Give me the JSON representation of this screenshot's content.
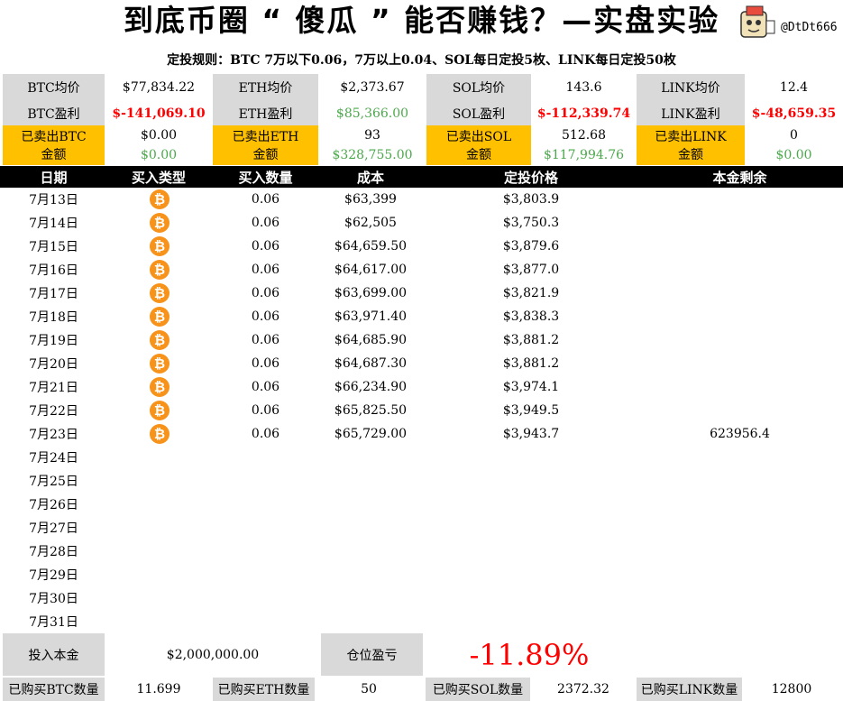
{
  "title": "到底币圈 “ 傻瓜 ” 能否赚钱？—实盘实验",
  "handle": "@DtDt666",
  "rule": "定投规则：BTC 7万以下0.06，7万以上0.04、SOL每日定投5枚、LINK每日定投50枚",
  "summary": {
    "row1": [
      {
        "label": "BTC均价",
        "value": "$77,834.22"
      },
      {
        "label": "ETH均价",
        "value": "$2,373.67"
      },
      {
        "label": "SOL均价",
        "value": "143.6"
      },
      {
        "label": "LINK均价",
        "value": "12.4"
      }
    ],
    "row2": [
      {
        "label": "BTC盈利",
        "value": "$-141,069.10"
      },
      {
        "label": "ETH盈利",
        "value": "$85,366.00"
      },
      {
        "label": "SOL盈利",
        "value": "$-112,339.74"
      },
      {
        "label": "LINK盈利",
        "value": "$-48,659.35"
      }
    ],
    "sold": [
      {
        "label1": "已卖出BTC",
        "label2": "金额",
        "qty": "$0.00",
        "amount": "$0.00"
      },
      {
        "label1": "已卖出ETH",
        "label2": "金额",
        "qty": "93",
        "amount": "$328,755.00"
      },
      {
        "label1": "已卖出SOL",
        "label2": "金额",
        "qty": "512.68",
        "amount": "$117,994.76"
      },
      {
        "label1": "已卖出LINK",
        "label2": "金额",
        "qty": "0",
        "amount": "$0.00"
      }
    ]
  },
  "table": {
    "headers": [
      "日期",
      "买入类型",
      "买入数量",
      "成本",
      "定投价格",
      "本金剩余"
    ],
    "rows": [
      {
        "date": "7月13日",
        "icon": "bitcoin-icon",
        "qty": "0.06",
        "cost": "$63,399",
        "price": "$3,803.9",
        "remaining": ""
      },
      {
        "date": "7月14日",
        "icon": "bitcoin-icon",
        "qty": "0.06",
        "cost": "$62,505",
        "price": "$3,750.3",
        "remaining": ""
      },
      {
        "date": "7月15日",
        "icon": "bitcoin-icon",
        "qty": "0.06",
        "cost": "$64,659.50",
        "price": "$3,879.6",
        "remaining": ""
      },
      {
        "date": "7月16日",
        "icon": "bitcoin-icon",
        "qty": "0.06",
        "cost": "$64,617.00",
        "price": "$3,877.0",
        "remaining": ""
      },
      {
        "date": "7月17日",
        "icon": "bitcoin-icon",
        "qty": "0.06",
        "cost": "$63,699.00",
        "price": "$3,821.9",
        "remaining": ""
      },
      {
        "date": "7月18日",
        "icon": "bitcoin-icon",
        "qty": "0.06",
        "cost": "$63,971.40",
        "price": "$3,838.3",
        "remaining": ""
      },
      {
        "date": "7月19日",
        "icon": "bitcoin-icon",
        "qty": "0.06",
        "cost": "$64,685.90",
        "price": "$3,881.2",
        "remaining": ""
      },
      {
        "date": "7月20日",
        "icon": "bitcoin-icon",
        "qty": "0.06",
        "cost": "$64,687.30",
        "price": "$3,881.2",
        "remaining": ""
      },
      {
        "date": "7月21日",
        "icon": "bitcoin-icon",
        "qty": "0.06",
        "cost": "$66,234.90",
        "price": "$3,974.1",
        "remaining": ""
      },
      {
        "date": "7月22日",
        "icon": "bitcoin-icon",
        "qty": "0.06",
        "cost": "$65,825.50",
        "price": "$3,949.5",
        "remaining": ""
      },
      {
        "date": "7月23日",
        "icon": "bitcoin-icon",
        "qty": "0.06",
        "cost": "$65,729.00",
        "price": "$3,943.7",
        "remaining": "623956.4"
      },
      {
        "date": "7月24日"
      },
      {
        "date": "7月25日"
      },
      {
        "date": "7月26日"
      },
      {
        "date": "7月27日"
      },
      {
        "date": "7月28日"
      },
      {
        "date": "7月29日"
      },
      {
        "date": "7月30日"
      },
      {
        "date": "7月31日"
      }
    ]
  },
  "footer": {
    "principal_label": "投入本金",
    "principal_value": "$2,000,000.00",
    "pnl_label": "仓位盈亏",
    "pnl_value": "-11.89%",
    "counts": [
      {
        "label": "已购买BTC数量",
        "value": "11.699"
      },
      {
        "label": "已购买ETH数量",
        "value": "50"
      },
      {
        "label": "已购买SOL数量",
        "value": "2372.32"
      },
      {
        "label": "已购买LINK数量",
        "value": "12800"
      }
    ]
  },
  "colors": {
    "red": "#ff0000",
    "green": "#4ca84c",
    "gold": "#ffc000",
    "gray": "#d9d9d9",
    "bitcoin": "#f7931a"
  }
}
